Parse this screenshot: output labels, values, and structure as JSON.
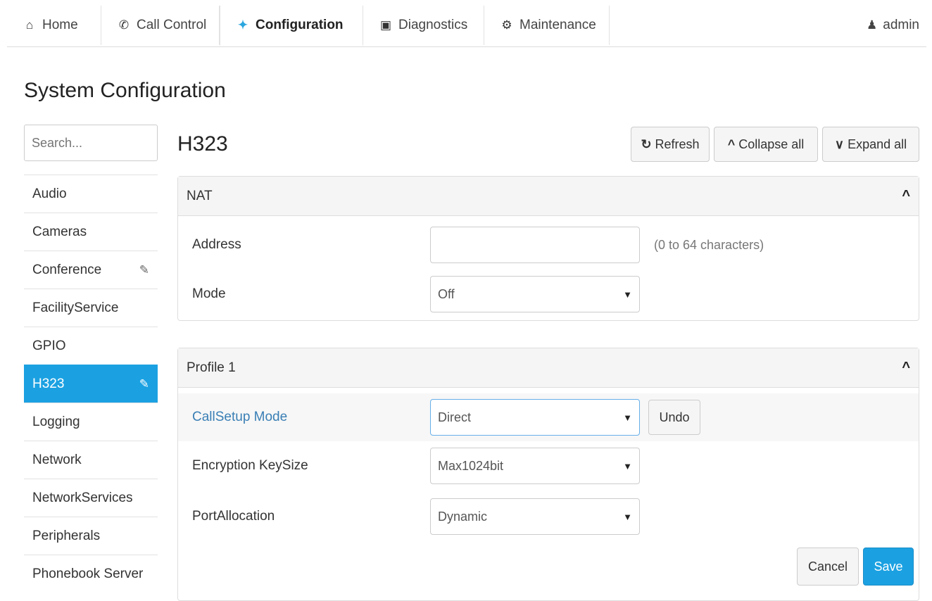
{
  "nav": {
    "tabs": [
      {
        "label": "Home",
        "icon": "home-icon"
      },
      {
        "label": "Call Control",
        "icon": "phone-icon"
      },
      {
        "label": "Configuration",
        "icon": "wrench-icon"
      },
      {
        "label": "Diagnostics",
        "icon": "medkit-icon"
      },
      {
        "label": "Maintenance",
        "icon": "gear-icon"
      }
    ],
    "active_tab": "Configuration",
    "user": "admin"
  },
  "page_title": "System Configuration",
  "sidebar": {
    "search_placeholder": "Search...",
    "items": [
      {
        "label": "Audio"
      },
      {
        "label": "Cameras"
      },
      {
        "label": "Conference",
        "edited": true
      },
      {
        "label": "FacilityService"
      },
      {
        "label": "GPIO"
      },
      {
        "label": "H323",
        "edited": true,
        "active": true
      },
      {
        "label": "Logging"
      },
      {
        "label": "Network"
      },
      {
        "label": "NetworkServices"
      },
      {
        "label": "Peripherals"
      },
      {
        "label": "Phonebook Server"
      }
    ]
  },
  "main": {
    "section_title": "H323",
    "toolbar": {
      "refresh": "Refresh",
      "collapse_all": "Collapse all",
      "expand_all": "Expand all"
    },
    "panels": [
      {
        "title": "NAT",
        "rows": [
          {
            "label": "Address",
            "value": "",
            "hint": "(0 to 64 characters)"
          },
          {
            "label": "Mode",
            "value": "Off"
          }
        ]
      },
      {
        "title": "Profile 1",
        "rows": [
          {
            "label": "CallSetup Mode",
            "value": "Direct",
            "undo": "Undo"
          },
          {
            "label": "Encryption KeySize",
            "value": "Max1024bit"
          },
          {
            "label": "PortAllocation",
            "value": "Dynamic"
          }
        ]
      }
    ],
    "cancel": "Cancel",
    "save": "Save"
  },
  "colors": {
    "accent": "#1ba1e2",
    "modified_label": "#3a7fb5"
  }
}
